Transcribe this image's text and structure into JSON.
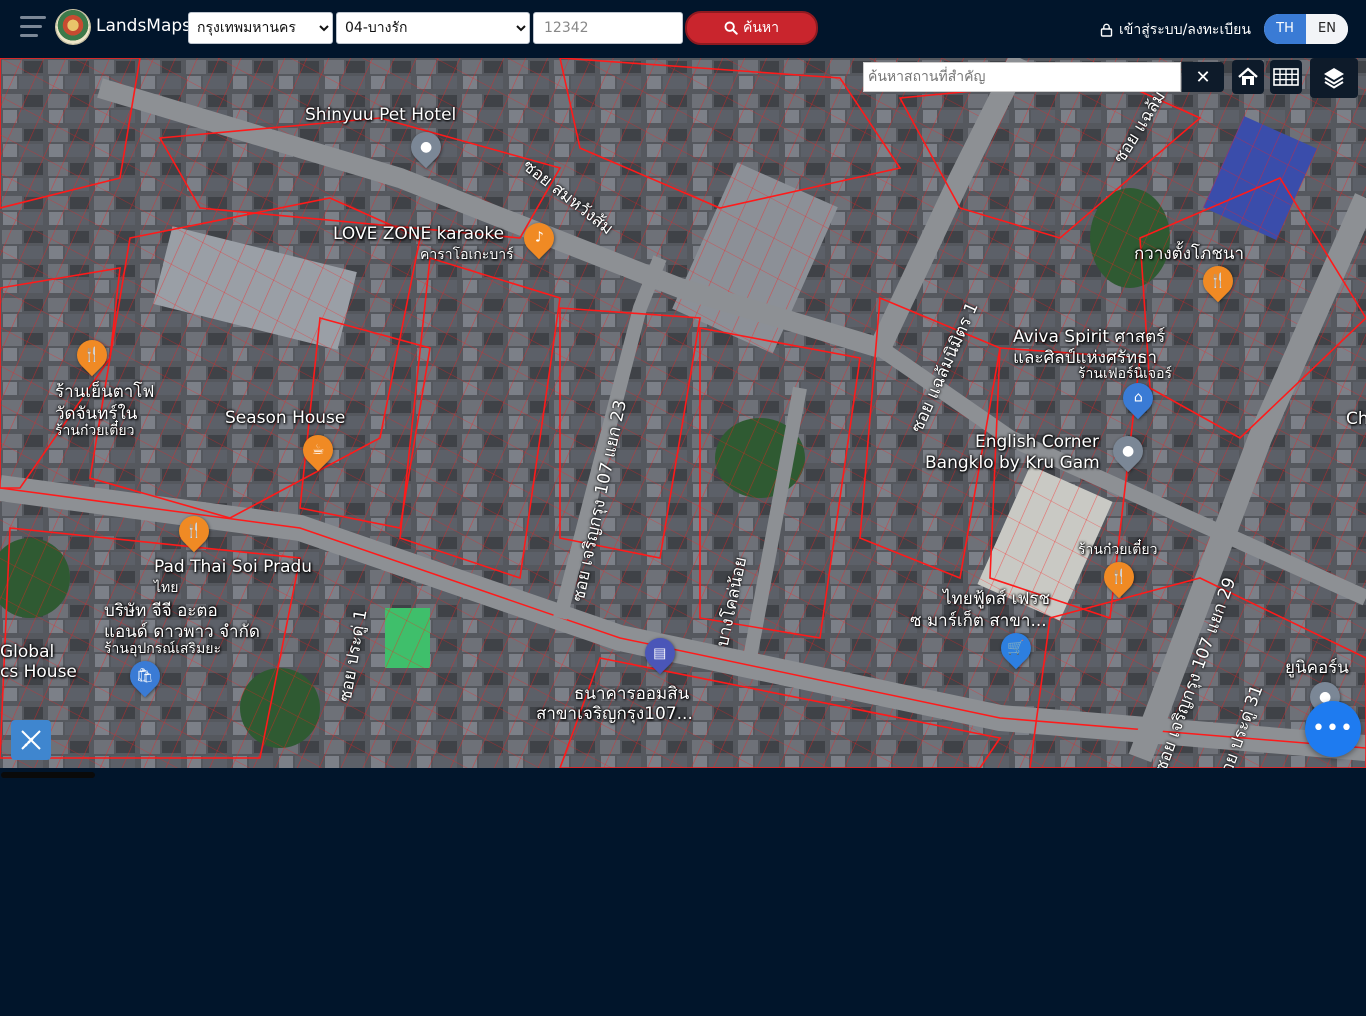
{
  "header": {
    "app_name": "LandsMaps",
    "province": {
      "selected": "กรุงเทพมหานคร",
      "options": [
        "กรุงเทพมหานคร"
      ]
    },
    "district": {
      "selected": "04-บางรัก",
      "options": [
        "04-บางรัก"
      ]
    },
    "parcel_number": "12342",
    "search_label": "ค้นหา",
    "login_label": "เข้าสู่ระบบ/ลงทะเบียน",
    "languages": [
      "TH",
      "EN"
    ],
    "active_language": "TH"
  },
  "map": {
    "place_search_placeholder": "ค้นหาสถานที่สำคัญ",
    "labels": {
      "shinyuu": "Shinyuu Pet Hotel",
      "lovezone": "LOVE ZONE karaoke",
      "lovezone_th": "คาราโอเกะบาร์",
      "season": "Season House",
      "yenta": "ร้านเย็นตาโฟ",
      "yenta2": "วัดจันทร์ใน",
      "noodle1": "ร้านก๋วยเตี๋ยว",
      "padthai": "Pad Thai Soi Pradu",
      "padthai2": "ไทย",
      "company1": "บริษัท จีจี อะตอ",
      "company2": "แอนด์ ดาวพาว จำกัด",
      "equip": "ร้านอุปกรณ์เสริมยะ",
      "global1": "Global",
      "global2": "cs House",
      "gsb1": "ธนาคารออมสิน",
      "gsb2": "สาขาเจริญกรุง107...",
      "kwang": "กวางตั้งโภชนา",
      "aviva1": "Aviva Spirit ศาสตร์",
      "aviva2": "และศิลป์แห่งศรัทธา",
      "furniture": "ร้านเฟอร์นิเจอร์",
      "english1": "English Corner",
      "english2": "Bangklo by Kru Gam",
      "noodle2": "ร้านก๋วยเตี๋ยว",
      "thaifoods1": "ไทยฟู้ดส์ เฟรช",
      "thaifoods2": "ซ มาร์เก็ต สาขา...",
      "unicorn": "ยูนิคอร์น",
      "ch": "Ch",
      "soi_samret": "ซอย สมหวังส้ม",
      "soi_107_23": "ซอย เจริญกรุง 107 แยก 23",
      "soi_jaeng": "ซอย แฉล้มนิมิตร 1",
      "soi_jaeng2": "ซอย แฉล้ม",
      "soi_107_29": "ซอย เจริญกรุง 107 แยก 29",
      "soi_pradu": "ซอย ประดู่ 1",
      "soi_pradu31": "ซอย ประดู่ 31",
      "soi_kok": "บางโคล่น้อย"
    }
  },
  "icons": {
    "menu": "hamburger-menu-icon",
    "search": "magnifier-icon",
    "lock": "lock-icon",
    "close": "close-icon",
    "home": "home-icon",
    "grid": "grid-icon",
    "layers": "layers-icon",
    "measure": "ruler-pencil-icon",
    "more": "more-dots-icon"
  },
  "colors": {
    "background": "#01152b",
    "search_button": "#c9252d",
    "lang_active": "#3a7bd5",
    "parcel_lines": "#ff1a1a",
    "fab": "#1e7bf0"
  }
}
